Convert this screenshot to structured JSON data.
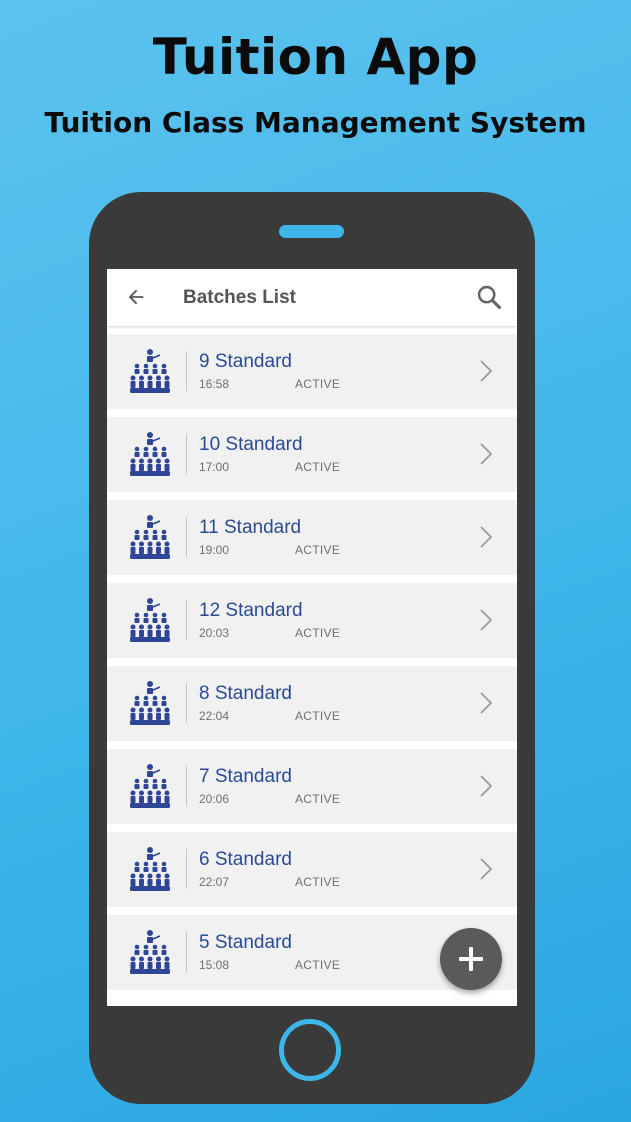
{
  "promo": {
    "title": "Tuition App",
    "subtitle": "Tuition Class Management System"
  },
  "appbar": {
    "back_icon": "arrow-left-icon",
    "title": "Batches List",
    "search_icon": "search-icon"
  },
  "batches": [
    {
      "name": "9 Standard",
      "time": "16:58",
      "status": "ACTIVE"
    },
    {
      "name": "10 Standard",
      "time": "17:00",
      "status": "ACTIVE"
    },
    {
      "name": "11 Standard",
      "time": "19:00",
      "status": "ACTIVE"
    },
    {
      "name": "12 Standard",
      "time": "20:03",
      "status": "ACTIVE"
    },
    {
      "name": "8 Standard",
      "time": "22:04",
      "status": "ACTIVE"
    },
    {
      "name": "7 Standard",
      "time": "20:06",
      "status": "ACTIVE"
    },
    {
      "name": "6 Standard",
      "time": "22:07",
      "status": "ACTIVE"
    },
    {
      "name": "5 Standard",
      "time": "15:08",
      "status": "ACTIVE"
    }
  ],
  "fab": {
    "icon": "plus-icon"
  },
  "colors": {
    "background": "#3fb6ea",
    "phone_body": "#3a3a3a",
    "batch_name": "#2c4a94",
    "batch_icon": "#2f4596",
    "fab": "#5a5a5a"
  }
}
